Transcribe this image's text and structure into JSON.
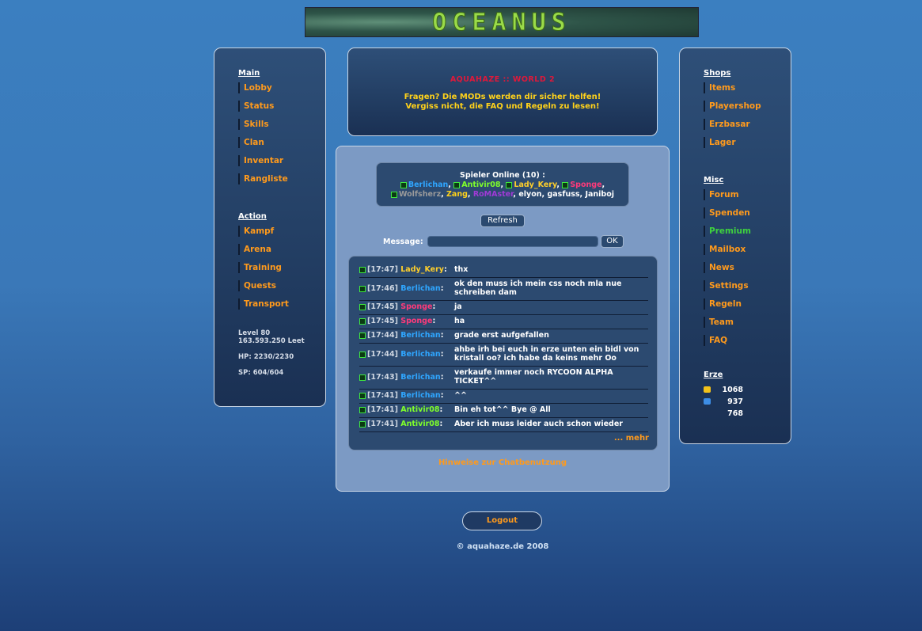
{
  "logo_text": "OCEANUS",
  "left_nav": {
    "main_heading": "Main",
    "main_items": [
      "Lobby",
      "Status",
      "Skills",
      "Clan",
      "Inventar",
      "Rangliste"
    ],
    "action_heading": "Action",
    "action_items": [
      "Kampf",
      "Arena",
      "Training",
      "Quests",
      "Transport"
    ],
    "stats": {
      "level": "Level 80",
      "leet": "163.593.250 Leet",
      "hp": "HP: 2230/2230",
      "sp": "SP: 604/604"
    }
  },
  "right_nav": {
    "shops_heading": "Shops",
    "shops_items": [
      "Items",
      "Playershop",
      "Erzbasar",
      "Lager"
    ],
    "misc_heading": "Misc",
    "misc_items": [
      "Forum",
      "Spenden",
      "Premium",
      "Mailbox",
      "News",
      "Settings",
      "Regeln",
      "Team",
      "FAQ"
    ],
    "erze_heading": "Erze",
    "erze": [
      {
        "value": "1068",
        "color": "#f2c21a"
      },
      {
        "value": "937",
        "color": "#3d8ee6"
      },
      {
        "value": "768",
        "color": ""
      }
    ]
  },
  "welcome": {
    "title": "AQUAHAZE :: WORLD 2",
    "line1": "Fragen? Die MODs werden dir sicher helfen!",
    "line2": "Vergiss nicht, die FAQ und Regeln zu lesen!"
  },
  "online": {
    "heading": "Spieler Online (10) :",
    "players": [
      "Berlichan",
      "Antivir08",
      "Lady_Kery",
      "Sponge",
      "Wolfsherz",
      "Zang",
      "RoMAster",
      "elyon",
      "gasfuss",
      "Janiboj"
    ]
  },
  "refresh_label": "Refresh",
  "message_label": "Message:",
  "message_value": "",
  "ok_label": "OK",
  "chat": [
    {
      "time": "[17:47]",
      "user": "Lady_Kery",
      "text": "thx"
    },
    {
      "time": "[17:46]",
      "user": "Berlichan",
      "text": "ok den muss ich mein css noch mla nue schreiben dam"
    },
    {
      "time": "[17:45]",
      "user": "Sponge",
      "text": "ja"
    },
    {
      "time": "[17:45]",
      "user": "Sponge",
      "text": "ha"
    },
    {
      "time": "[17:44]",
      "user": "Berlichan",
      "text": "grade erst aufgefallen"
    },
    {
      "time": "[17:44]",
      "user": "Berlichan",
      "text": "ahbe irh bei euch in erze unten ein bidl von kristall oo? ich habe da keins mehr Oo"
    },
    {
      "time": "[17:43]",
      "user": "Berlichan",
      "text": "verkaufe immer noch RYCOON ALPHA TICKET^^"
    },
    {
      "time": "[17:41]",
      "user": "Berlichan",
      "text": "^^"
    },
    {
      "time": "[17:41]",
      "user": "Antivir08",
      "text": "Bin eh tot^^ Bye @ All"
    },
    {
      "time": "[17:41]",
      "user": "Antivir08",
      "text": "Aber ich muss leider auch schon wieder"
    }
  ],
  "more_label": "... mehr",
  "hint_label": "Hinweise zur Chatbenutzung",
  "logout_label": "Logout",
  "copyright": "© aquahaze.de 2008",
  "colors": {
    "link_orange": "#ff9a1c",
    "premium_green": "#3ed13e",
    "title_red": "#e0183a",
    "notice_yellow": "#ffd21a"
  }
}
